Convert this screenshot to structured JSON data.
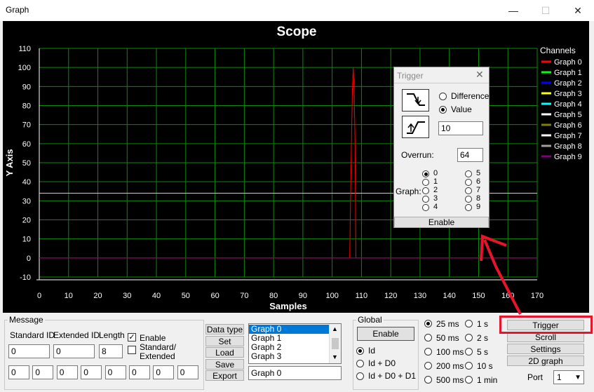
{
  "window": {
    "title": "Graph",
    "minimize": "—",
    "maximize": "☐",
    "close": "✕"
  },
  "chart_data": {
    "type": "line",
    "title": "Scope",
    "xlabel": "Samples",
    "ylabel": "Y Axis",
    "xlim": [
      0,
      170
    ],
    "ylim": [
      -10,
      110
    ],
    "xticks": [
      0,
      10,
      20,
      30,
      40,
      50,
      60,
      70,
      80,
      90,
      100,
      110,
      120,
      130,
      140,
      150,
      160,
      170
    ],
    "yticks": [
      -10,
      0,
      10,
      20,
      30,
      40,
      50,
      60,
      70,
      80,
      90,
      100,
      110
    ],
    "grid": true,
    "legend_title": "Channels",
    "legend_position": "right",
    "trigger_level": 34,
    "trigger_color": "#b4f04a",
    "series": [
      {
        "name": "Graph 0",
        "color": "#ff0000",
        "x": [
          0,
          106,
          106.3,
          106.6,
          106.9,
          107.2,
          107.5,
          107.8,
          108.1,
          170
        ],
        "y": [
          0,
          0,
          34,
          62,
          88,
          100,
          88,
          62,
          0,
          0
        ]
      },
      {
        "name": "Graph 1",
        "color": "#00ff00",
        "x": [],
        "y": []
      },
      {
        "name": "Graph 2",
        "color": "#0000ff",
        "x": [],
        "y": []
      },
      {
        "name": "Graph 3",
        "color": "#ffff00",
        "x": [],
        "y": []
      },
      {
        "name": "Graph 4",
        "color": "#00ffff",
        "x": [],
        "y": []
      },
      {
        "name": "Graph 5",
        "color": "#ffffff",
        "x": [],
        "y": []
      },
      {
        "name": "Graph 6",
        "color": "#808000",
        "x": [],
        "y": []
      },
      {
        "name": "Graph 7",
        "color": "#ffffff",
        "x": [],
        "y": []
      },
      {
        "name": "Graph 8",
        "color": "#a0a0a0",
        "x": [],
        "y": []
      },
      {
        "name": "Graph 9",
        "color": "#800080",
        "x": [
          0,
          170
        ],
        "y": [
          0,
          0
        ]
      }
    ]
  },
  "trigger": {
    "title": "Trigger",
    "difference": "Difference",
    "value_label": "Value",
    "value": "10",
    "overrun_label": "Overrun:",
    "overrun": "64",
    "graph_label": "Graph:",
    "graph_options_left": [
      "0",
      "1",
      "2",
      "3",
      "4"
    ],
    "graph_options_right": [
      "5",
      "6",
      "7",
      "8",
      "9"
    ],
    "enable": "Enable"
  },
  "message": {
    "legend": "Message",
    "standard_id_label": "Standard ID",
    "extended_id_label": "Extended ID",
    "length_label": "Length",
    "standard_id": "0",
    "extended_id": "0",
    "length": "8",
    "enable_label": "Enable",
    "std_ext_label1": "Standard/",
    "std_ext_label2": "Extended",
    "bytes": [
      "0",
      "0",
      "0",
      "0",
      "0",
      "0",
      "0",
      "0"
    ],
    "buttons": [
      "Data type",
      "Set",
      "Load",
      "Save",
      "Export"
    ],
    "list_items": [
      "Graph 0",
      "Graph 1",
      "Graph 2",
      "Graph 3"
    ],
    "selected_graph": "Graph 0"
  },
  "global": {
    "legend": "Global",
    "enable": "Enable",
    "options": [
      "Id",
      "Id + D0",
      "Id + D0 + D1"
    ]
  },
  "timing": {
    "left": [
      "25 ms",
      "50 ms",
      "100 ms",
      "200 ms",
      "500 ms"
    ],
    "right": [
      "1 s",
      "2 s",
      "5 s",
      "10 s",
      "1 min"
    ]
  },
  "side_buttons": [
    "Trigger",
    "Scroll",
    "Settings",
    "2D graph"
  ],
  "port": {
    "label": "Port",
    "value": "1"
  }
}
